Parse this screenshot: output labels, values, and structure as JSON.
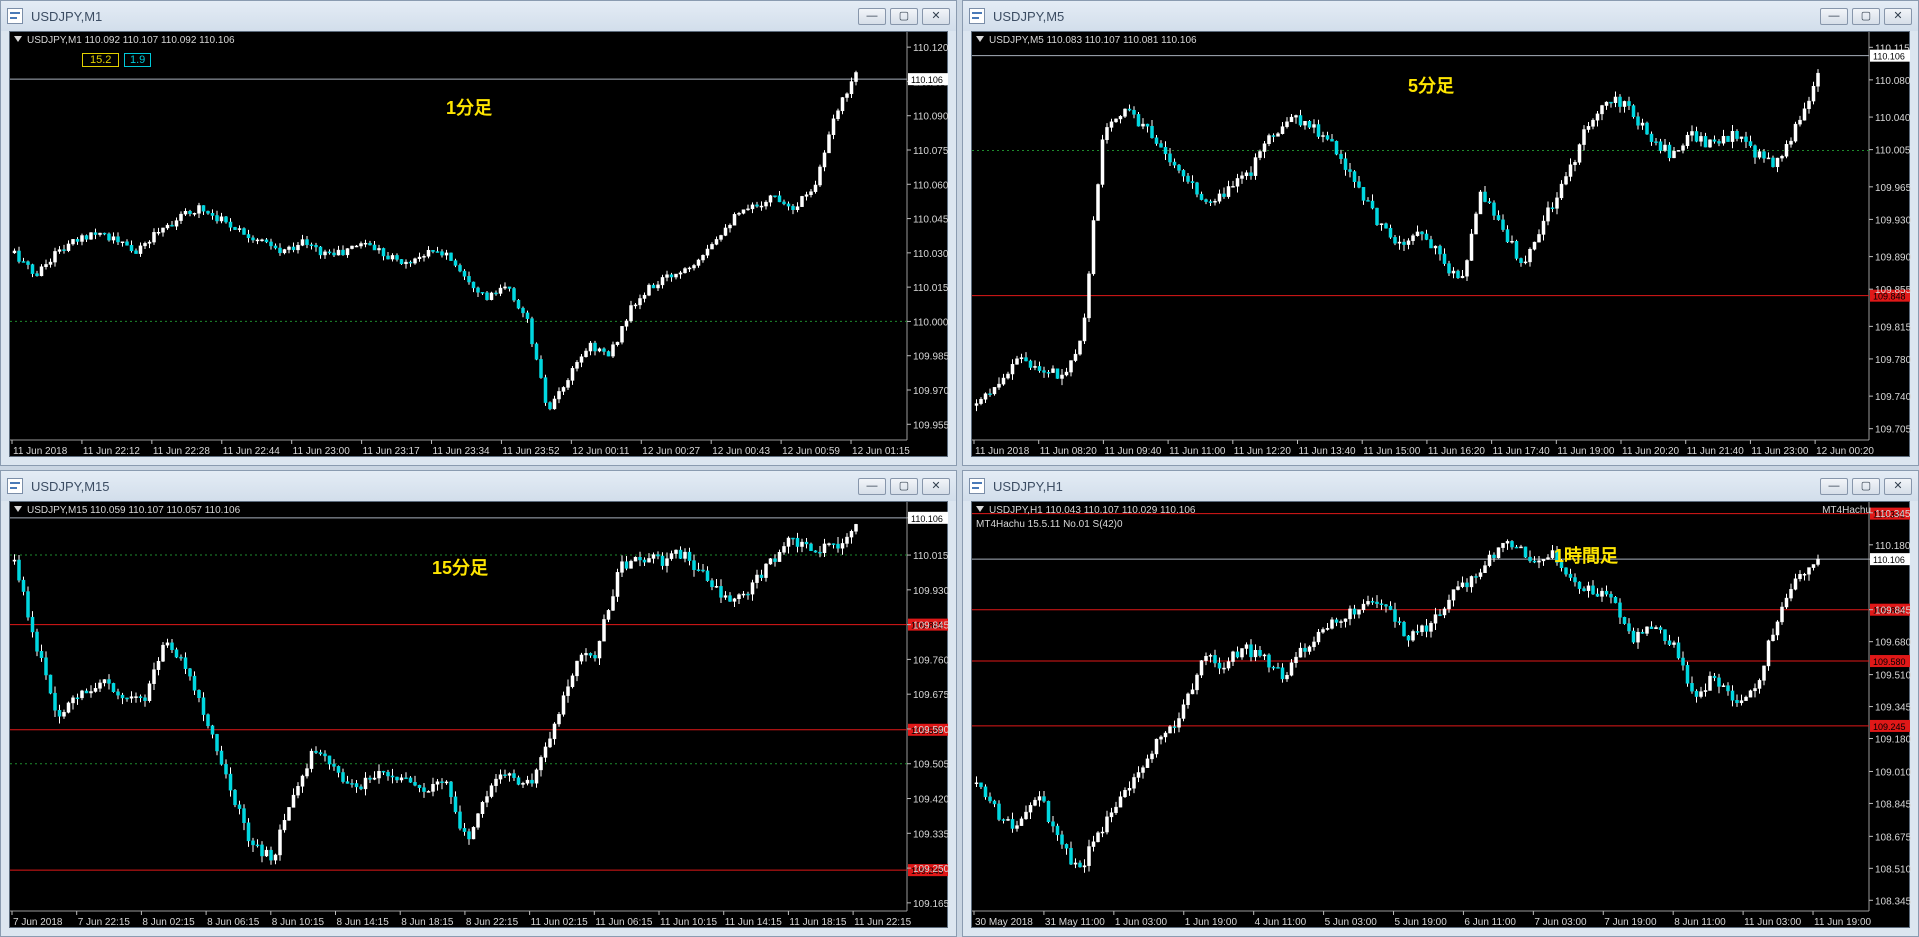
{
  "windows": [
    {
      "title": "USDJPY,M1",
      "header": "USDJPY,M1  110.092 110.107 110.092 110.106",
      "label": "1分足",
      "indicator_left": "15.2",
      "indicator_right": "1.9",
      "y_ticks": [
        "110.120",
        "110.105",
        "110.090",
        "110.075",
        "110.060",
        "110.045",
        "110.030",
        "110.015",
        "110.000",
        "109.985",
        "109.970",
        "109.955"
      ],
      "y_tick_values": [
        110.12,
        110.105,
        110.09,
        110.075,
        110.06,
        110.045,
        110.03,
        110.015,
        110.0,
        109.985,
        109.97,
        109.955
      ],
      "x_ticks": [
        "11 Jun 2018",
        "11 Jun 22:12",
        "11 Jun 22:28",
        "11 Jun 22:44",
        "11 Jun 23:00",
        "11 Jun 23:17",
        "11 Jun 23:34",
        "11 Jun 23:52",
        "12 Jun 00:11",
        "12 Jun 00:27",
        "12 Jun 00:43",
        "12 Jun 00:59",
        "12 Jun 01:15"
      ],
      "current_price": "110.106",
      "current_value": 110.106,
      "red_lines": [],
      "green_dotted": [
        110.0
      ],
      "ylim": [
        109.949,
        110.124
      ],
      "path": [
        110.03,
        110.02,
        110.03,
        110.035,
        110.04,
        110.035,
        110.03,
        110.04,
        110.045,
        110.05,
        110.045,
        110.04,
        110.035,
        110.03,
        110.035,
        110.03,
        110.03,
        110.035,
        110.03,
        110.025,
        110.03,
        110.03,
        110.02,
        110.01,
        110.015,
        110.0,
        109.96,
        109.975,
        109.99,
        109.985,
        110.005,
        110.015,
        110.02,
        110.025,
        110.035,
        110.045,
        110.05,
        110.055,
        110.05,
        110.06,
        110.09,
        110.11
      ],
      "volatility": 0.0035
    },
    {
      "title": "USDJPY,M5",
      "header": "USDJPY,M5  110.083 110.107 110.081 110.106",
      "label": "5分足",
      "y_ticks": [
        "110.115",
        "110.080",
        "110.040",
        "110.005",
        "109.965",
        "109.930",
        "109.890",
        "109.855",
        "109.815",
        "109.780",
        "109.740",
        "109.705"
      ],
      "y_tick_values": [
        110.115,
        110.08,
        110.04,
        110.005,
        109.965,
        109.93,
        109.89,
        109.855,
        109.815,
        109.78,
        109.74,
        109.705
      ],
      "x_ticks": [
        "11 Jun 2018",
        "11 Jun 08:20",
        "11 Jun 09:40",
        "11 Jun 11:00",
        "11 Jun 12:20",
        "11 Jun 13:40",
        "11 Jun 15:00",
        "11 Jun 16:20",
        "11 Jun 17:40",
        "11 Jun 19:00",
        "11 Jun 20:20",
        "11 Jun 21:40",
        "11 Jun 23:00",
        "12 Jun 00:20"
      ],
      "current_price": "110.106",
      "current_value": 110.106,
      "red_lines": [
        {
          "value": 109.848,
          "label": "109.848"
        }
      ],
      "green_dotted": [
        110.004
      ],
      "ylim": [
        109.695,
        110.125
      ],
      "path": [
        109.73,
        109.75,
        109.78,
        109.77,
        109.76,
        109.8,
        110.02,
        110.05,
        110.03,
        110.0,
        109.97,
        109.95,
        109.96,
        109.98,
        110.02,
        110.04,
        110.03,
        110.01,
        109.97,
        109.93,
        109.9,
        109.92,
        109.89,
        109.86,
        109.96,
        109.92,
        109.88,
        109.93,
        109.97,
        110.03,
        110.06,
        110.05,
        110.02,
        110.0,
        110.02,
        110.01,
        110.02,
        110.0,
        109.99,
        110.03,
        110.085
      ],
      "volatility": 0.012
    },
    {
      "title": "USDJPY,M15",
      "header": "USDJPY,M15  110.059 110.107 110.057 110.106",
      "label": "15分足",
      "y_ticks": [
        "110.106",
        "110.015",
        "109.930",
        "109.845",
        "109.760",
        "109.675",
        "109.590",
        "109.505",
        "109.420",
        "109.335",
        "109.250",
        "109.165"
      ],
      "y_tick_values": [
        110.106,
        110.015,
        109.93,
        109.845,
        109.76,
        109.675,
        109.59,
        109.505,
        109.42,
        109.335,
        109.25,
        109.165
      ],
      "x_ticks": [
        "7 Jun 2018",
        "7 Jun 22:15",
        "8 Jun 02:15",
        "8 Jun 06:15",
        "8 Jun 10:15",
        "8 Jun 14:15",
        "8 Jun 18:15",
        "8 Jun 22:15",
        "11 Jun 02:15",
        "11 Jun 06:15",
        "11 Jun 10:15",
        "11 Jun 14:15",
        "11 Jun 18:15",
        "11 Jun 22:15"
      ],
      "current_price": "110.106",
      "current_value": 110.106,
      "red_lines": [
        {
          "value": 109.845,
          "label": "109.845"
        },
        {
          "value": 109.588,
          "label": "109.588"
        },
        {
          "value": 109.245,
          "label": "109.245"
        }
      ],
      "green_dotted": [
        110.015,
        109.505
      ],
      "ylim": [
        109.15,
        110.13
      ],
      "path": [
        110.0,
        109.8,
        109.6,
        109.68,
        109.7,
        109.68,
        109.66,
        109.8,
        109.74,
        109.6,
        109.45,
        109.3,
        109.28,
        109.45,
        109.55,
        109.48,
        109.45,
        109.5,
        109.46,
        109.44,
        109.47,
        109.3,
        109.45,
        109.48,
        109.45,
        109.6,
        109.75,
        109.78,
        109.98,
        110.01,
        110.0,
        110.02,
        109.96,
        109.9,
        109.92,
        110.0,
        110.05,
        110.02,
        110.04,
        110.08
      ],
      "volatility": 0.03
    },
    {
      "title": "USDJPY,H1",
      "header": "USDJPY,H1  110.043 110.107 110.029 110.106",
      "sub_header": "MT4Hachu 15.5.11  No.01  S(42)0",
      "ribbon": "MT4Hachu",
      "label": "1時間足",
      "y_ticks": [
        "110.345",
        "110.180",
        "110.106",
        "109.845",
        "109.680",
        "109.510",
        "109.345",
        "109.180",
        "109.010",
        "108.845",
        "108.675",
        "108.510",
        "108.345"
      ],
      "y_tick_values": [
        110.345,
        110.18,
        110.106,
        109.845,
        109.68,
        109.51,
        109.345,
        109.18,
        109.01,
        108.845,
        108.675,
        108.51,
        108.345
      ],
      "x_ticks": [
        "30 May 2018",
        "31 May 11:00",
        "1 Jun 03:00",
        "1 Jun 19:00",
        "4 Jun 11:00",
        "5 Jun 03:00",
        "5 Jun 19:00",
        "6 Jun 11:00",
        "7 Jun 03:00",
        "7 Jun 19:00",
        "8 Jun 11:00",
        "11 Jun 03:00",
        "11 Jun 19:00"
      ],
      "current_price": "110.106",
      "current_value": 110.106,
      "red_lines": [
        {
          "value": 110.341,
          "label": "110.341"
        },
        {
          "value": 109.845,
          "label": "109.845"
        },
        {
          "value": 109.58,
          "label": "109.580"
        },
        {
          "value": 109.245,
          "label": "109.245"
        }
      ],
      "green_dotted": [],
      "ylim": [
        108.3,
        110.37
      ],
      "path": [
        108.95,
        108.8,
        108.7,
        108.9,
        108.65,
        108.5,
        108.7,
        108.85,
        109.0,
        109.2,
        109.3,
        109.6,
        109.55,
        109.65,
        109.6,
        109.5,
        109.65,
        109.75,
        109.8,
        109.9,
        109.85,
        109.7,
        109.75,
        109.9,
        110.0,
        110.1,
        110.2,
        110.1,
        110.15,
        110.0,
        109.95,
        109.9,
        109.7,
        109.75,
        109.65,
        109.4,
        109.5,
        109.35,
        109.45,
        109.8,
        110.0,
        110.08
      ],
      "volatility": 0.06
    }
  ]
}
